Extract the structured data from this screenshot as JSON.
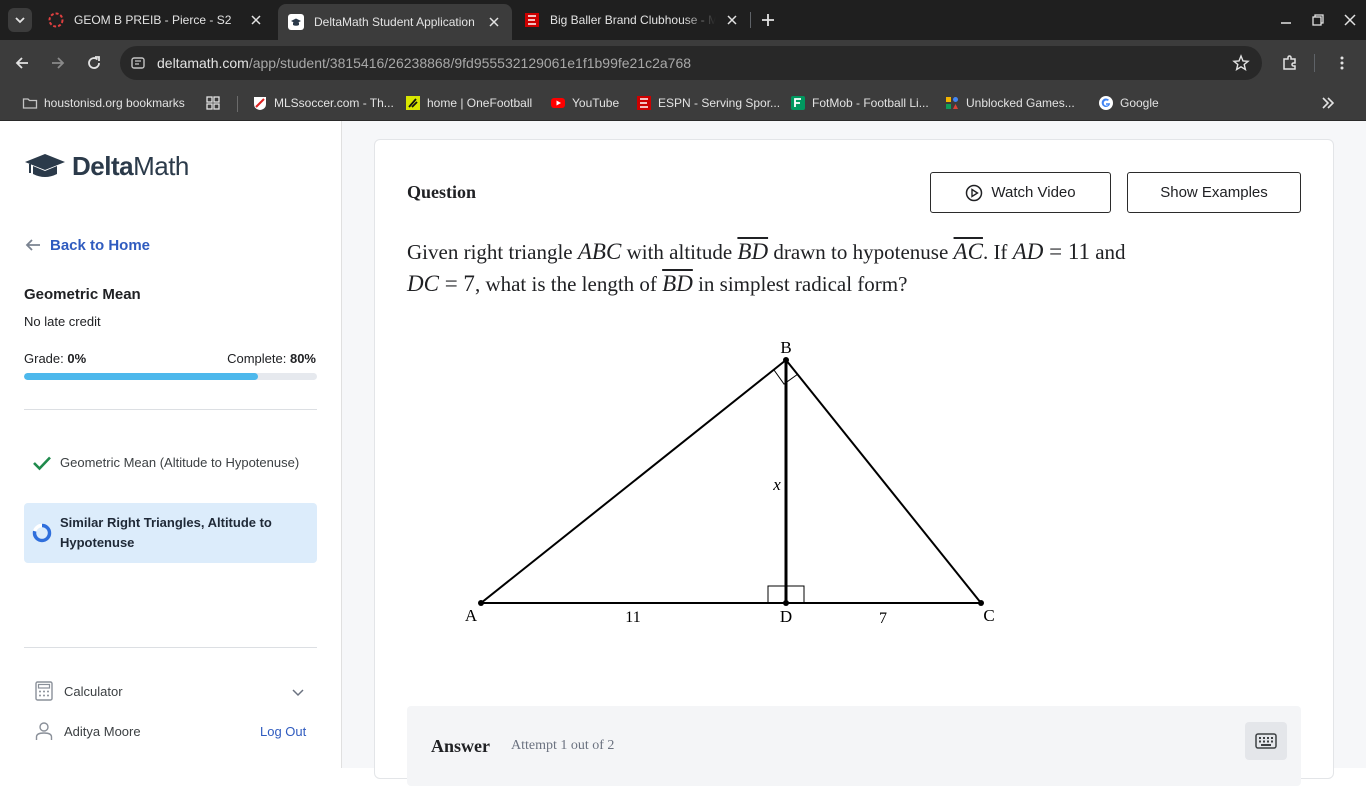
{
  "browser": {
    "tabs": [
      {
        "title": "GEOM B PREIB - Pierce - S2",
        "active": false
      },
      {
        "title": "DeltaMath Student Application",
        "active": true
      },
      {
        "title": "Big Baller Brand Clubhouse - M",
        "active": false
      }
    ],
    "url_host": "deltamath.com",
    "url_path": "/app/student/3815416/26238868/9fd955532129061e1f1b99fe21c2a768",
    "bookmarks": [
      {
        "label": "houstonisd.org bookmarks",
        "icon": "folder-icon"
      },
      {
        "label": "",
        "icon": "apps-grid-icon"
      },
      {
        "label": "MLSsoccer.com - Th...",
        "icon": "mls-icon"
      },
      {
        "label": "home | OneFootball",
        "icon": "onefootball-icon"
      },
      {
        "label": "YouTube",
        "icon": "youtube-icon"
      },
      {
        "label": "ESPN - Serving Spor...",
        "icon": "espn-icon"
      },
      {
        "label": "FotMob - Football Li...",
        "icon": "fotmob-icon"
      },
      {
        "label": "Unblocked Games...",
        "icon": "games-icon"
      },
      {
        "label": "Google",
        "icon": "google-icon"
      }
    ]
  },
  "sidebar": {
    "logo_delta": "Delta",
    "logo_math": "Math",
    "back_label": "Back to Home",
    "assignment_title": "Geometric Mean",
    "late_credit": "No late credit",
    "grade_label": "Grade:",
    "grade_value": "0%",
    "complete_label": "Complete:",
    "complete_value": "80%",
    "complete_fraction": 0.8,
    "skills": [
      {
        "label": "Geometric Mean (Altitude to Hypotenuse)",
        "status": "done"
      },
      {
        "label": "Similar Right Triangles, Altitude to Hypotenuse",
        "status": "in-progress"
      }
    ],
    "calculator_label": "Calculator",
    "user_name": "Aditya Moore",
    "logout_label": "Log Out"
  },
  "question": {
    "heading": "Question",
    "watch_video": "Watch Video",
    "show_examples": "Show Examples",
    "text": {
      "p1": "Given right triangle ",
      "abc": "ABC",
      "p2": " with altitude ",
      "bd": "BD",
      "p3": " drawn to hypotenuse ",
      "ac": "AC",
      "p4": ". If ",
      "ad": "AD",
      "eq1": " = 11",
      "p5": " and",
      "dc": "DC",
      "eq2": " = 7",
      "p6": ", what is the length of ",
      "bd2": "BD",
      "p7": " in simplest radical form?"
    },
    "figure": {
      "labels": {
        "A": "A",
        "B": "B",
        "C": "C",
        "D": "D"
      },
      "altitude_label": "x",
      "ad_label": "11",
      "dc_label": "7"
    }
  },
  "answer": {
    "label": "Answer",
    "attempt": "Attempt 1 out of 2"
  }
}
